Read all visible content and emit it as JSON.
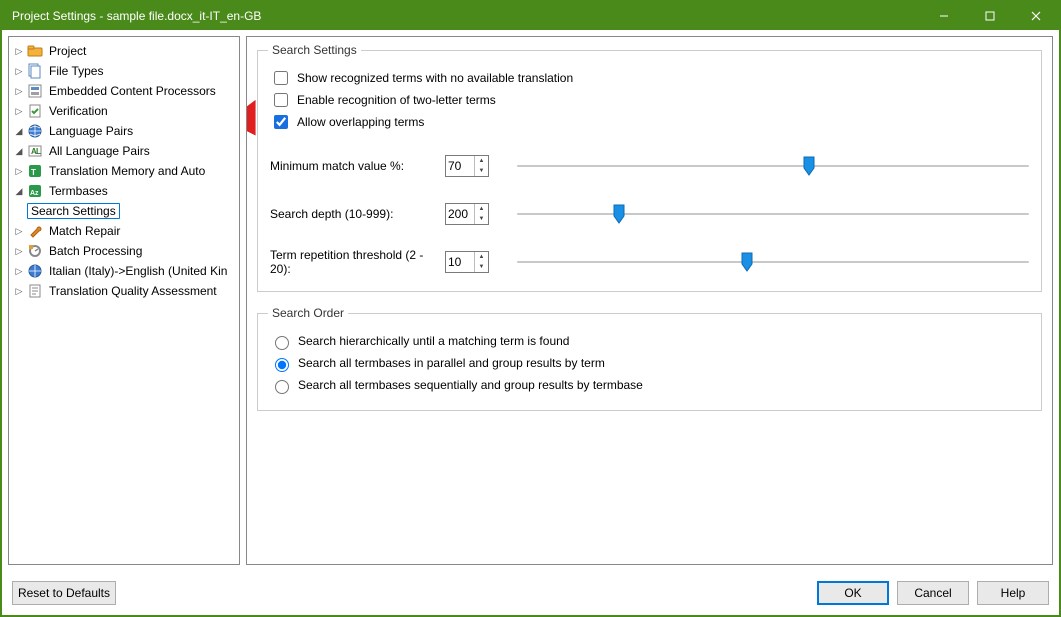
{
  "window": {
    "title": "Project Settings - sample file.docx_it-IT_en-GB"
  },
  "tree": {
    "project": "Project",
    "file_types": "File Types",
    "embedded": "Embedded Content Processors",
    "verification": "Verification",
    "language_pairs": "Language Pairs",
    "all_language_pairs": "All Language Pairs",
    "tm_auto": "Translation Memory and Auto",
    "termbases": "Termbases",
    "search_settings": "Search Settings",
    "match_repair": "Match Repair",
    "batch_processing": "Batch Processing",
    "italian_english": "Italian (Italy)->English (United Kin",
    "tqa": "Translation Quality Assessment"
  },
  "search_settings": {
    "legend": "Search Settings",
    "chk_show_recognized": "Show recognized terms with no available translation",
    "chk_enable_two_letter": "Enable recognition of two-letter terms",
    "chk_allow_overlap": "Allow overlapping terms",
    "min_match_label": "Minimum match value %:",
    "min_match_value": "70",
    "search_depth_label": "Search depth (10-999):",
    "search_depth_value": "200",
    "term_rep_label": "Term repetition threshold (2 - 20):",
    "term_rep_value": "10"
  },
  "search_order": {
    "legend": "Search Order",
    "r1": "Search hierarchically until a matching term is found",
    "r2": "Search all termbases in parallel and group results by term",
    "r3": "Search all termbases sequentially and group results by termbase"
  },
  "footer": {
    "reset": "Reset to Defaults",
    "ok": "OK",
    "cancel": "Cancel",
    "help": "Help"
  },
  "sliders": {
    "min_match_pct": 57,
    "search_depth_pct": 20,
    "term_rep_pct": 45
  }
}
